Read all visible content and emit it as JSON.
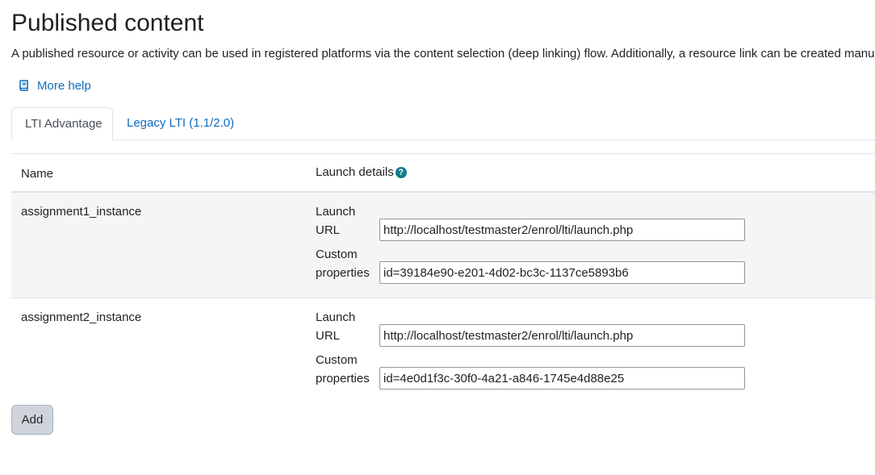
{
  "page": {
    "title": "Published content",
    "intro": "A published resource or activity can be used in registered platforms via the content selection (deep linking) flow. Additionally, a resource link can be created manually in a platform using the launch URL and custom properties below."
  },
  "help": {
    "label": "More help",
    "icon": "book-icon"
  },
  "tabs": [
    {
      "label": "LTI Advantage",
      "active": true
    },
    {
      "label": "Legacy LTI (1.1/2.0)",
      "active": false
    }
  ],
  "table": {
    "headers": {
      "name": "Name",
      "launch_details": "Launch details"
    },
    "help_icon": "question-circle-icon",
    "field_labels": {
      "launch_url_1": "Launch",
      "launch_url_2": "URL",
      "custom_props_1": "Custom",
      "custom_props_2": "properties"
    },
    "rows": [
      {
        "name": "assignment1_instance",
        "launch_url": "http://localhost/testmaster2/enrol/lti/launch.php",
        "custom_properties": "id=39184e90-e201-4d02-bc3c-1137ce5893b6"
      },
      {
        "name": "assignment2_instance",
        "launch_url": "http://localhost/testmaster2/enrol/lti/launch.php",
        "custom_properties": "id=4e0d1f3c-30f0-4a21-a846-1745e4d88e25"
      }
    ]
  },
  "actions": {
    "add_label": "Add"
  },
  "colors": {
    "link": "#0f6cbf",
    "help_icon": "#0f7a8c",
    "stripe": "#f5f5f5",
    "button_bg": "#ced4da"
  }
}
